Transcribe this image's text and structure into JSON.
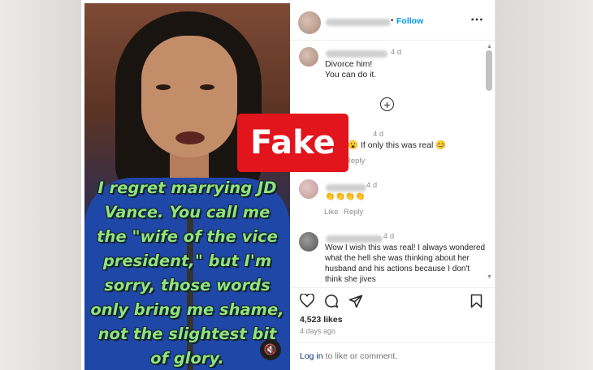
{
  "post": {
    "quote": "I regret marrying JD Vance. You call me the \"wife of the vice president,\" but I'm sorry, those words only bring me shame, not the slightest bit of glory.",
    "mute_icon": "mute-icon"
  },
  "header": {
    "follow": "Follow",
    "separator": "•",
    "more": "⋯"
  },
  "comments": [
    {
      "time": "4 d",
      "lines": [
        "Divorce him!",
        "You can do it."
      ]
    },
    {
      "time": "4 d",
      "text": "😮 If only this was real 😊",
      "reply": "Reply"
    },
    {
      "time": "4 d",
      "text": "👏👏👏👏",
      "like": "Like",
      "reply": "Reply"
    },
    {
      "time": "4 d",
      "text": "Wow I wish this was real! I always wondered what the hell she was thinking about her husband and his actions because I don't think she jives"
    }
  ],
  "load_more_icon": "plus-circle-icon",
  "actions": {
    "likes": "4,523 likes",
    "date": "4 days ago"
  },
  "footer": {
    "login": "Log in",
    "rest": " to like or comment."
  },
  "overlay": {
    "label": "Fake",
    "color": "#e2141c"
  }
}
